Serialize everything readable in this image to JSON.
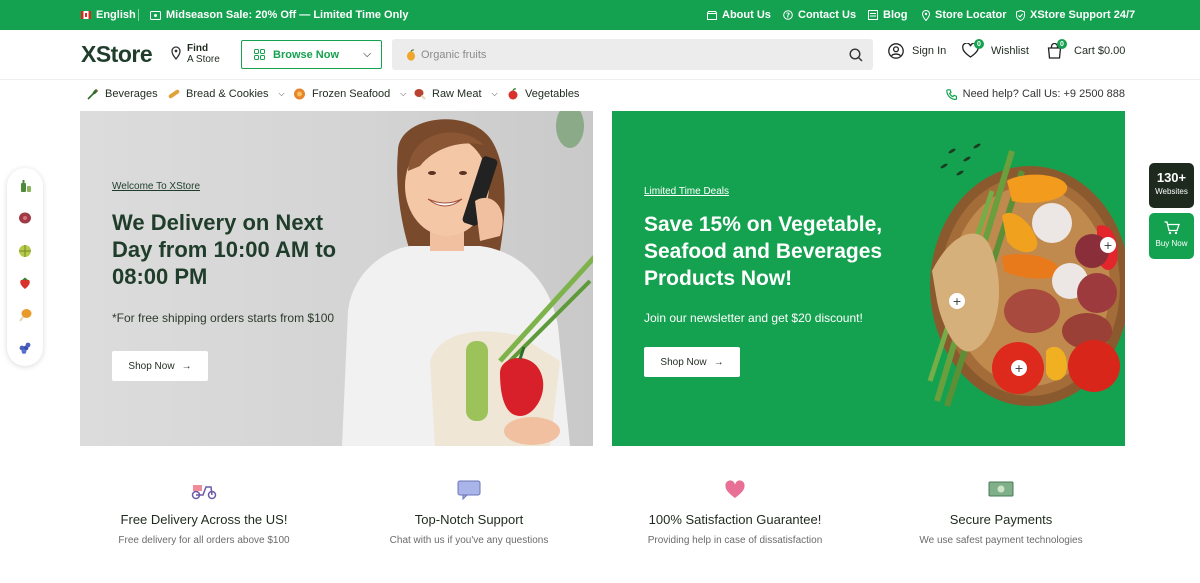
{
  "topbar": {
    "language": "English",
    "promo": "Midseason Sale: 20% Off — Limited Time Only",
    "links": [
      "About Us",
      "Contact Us",
      "Blog",
      "Store Locator",
      "XStore Support 24/7"
    ]
  },
  "header": {
    "logo": "XStore",
    "find_line1": "Find",
    "find_line2": "A Store",
    "browse_label": "Browse Now",
    "search_placeholder": "Organic fruits",
    "signin": "Sign In",
    "wishlist": "Wishlist",
    "wishlist_count": "0",
    "cart": "Cart $0.00",
    "cart_count": "0"
  },
  "nav": {
    "categories": [
      {
        "label": "Beverages",
        "icon": "bottle-icon"
      },
      {
        "label": "Bread & Cookies",
        "icon": "bread-icon"
      },
      {
        "label": "Frozen Seafood",
        "icon": "seafood-icon"
      },
      {
        "label": "Raw Meat",
        "icon": "meat-icon"
      },
      {
        "label": "Vegetables",
        "icon": "vegetable-icon"
      }
    ],
    "help": "Need help? Call Us: +9 2500 888"
  },
  "banner1": {
    "eyebrow": "Welcome To XStore",
    "title": "We Delivery on Next Day from 10:00 AM to 08:00 PM",
    "subtitle": "*For free shipping orders starts from $100",
    "button": "Shop Now"
  },
  "banner2": {
    "eyebrow": "Limited Time Deals",
    "title": "Save 15% on Vegetable, Seafood and Beverages Products Now!",
    "subtitle": "Join our newsletter and get $20 discount!",
    "button": "Shop Now"
  },
  "side": {
    "count": "130+",
    "count_label": "Websites",
    "buy_label": "Buy Now"
  },
  "features": [
    {
      "title": "Free Delivery Across the US!",
      "subtitle": "Free delivery for all orders above $100",
      "icon": "delivery-scooter-icon"
    },
    {
      "title": "Top-Notch Support",
      "subtitle": "Chat with us if you've any questions",
      "icon": "chat-icon"
    },
    {
      "title": "100% Satisfaction Guarantee!",
      "subtitle": "Providing help in case of dissatisfaction",
      "icon": "heart-icon"
    },
    {
      "title": "Secure Payments",
      "subtitle": "We use safest payment technologies",
      "icon": "money-icon"
    }
  ],
  "colors": {
    "brand": "#15a250",
    "dark": "#1f3d2a"
  }
}
